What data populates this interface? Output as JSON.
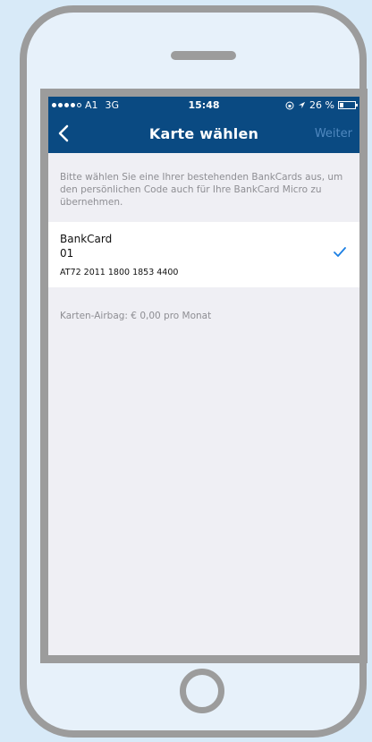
{
  "status_bar": {
    "carrier": "A1",
    "network": "3G",
    "time": "15:48",
    "battery": "26 %",
    "battery_level": 0.26,
    "icons": [
      "signal-dots-icon",
      "lock-rotation-icon",
      "location-arrow-icon",
      "battery-icon"
    ]
  },
  "nav": {
    "title": "Karte wählen",
    "back_icon": "chevron-left-icon",
    "action_label": "Weiter"
  },
  "content": {
    "intro": "Bitte wählen Sie eine Ihrer bestehenden BankCards aus, um den persönlichen Code auch für Ihre BankCard Micro zu übernehmen.",
    "card": {
      "name": "BankCard",
      "number": "01",
      "iban": "AT72 2011 1800 1853 4400",
      "selected": true
    },
    "airbag": "Karten-Airbag: € 0,00 pro Monat"
  },
  "colors": {
    "nav_background": "#0a4a82",
    "screen_background": "#efeff4",
    "checkmark": "#1b7fe3",
    "device_frame": "#9c9c9c",
    "page_background": "#d8eaf8"
  }
}
